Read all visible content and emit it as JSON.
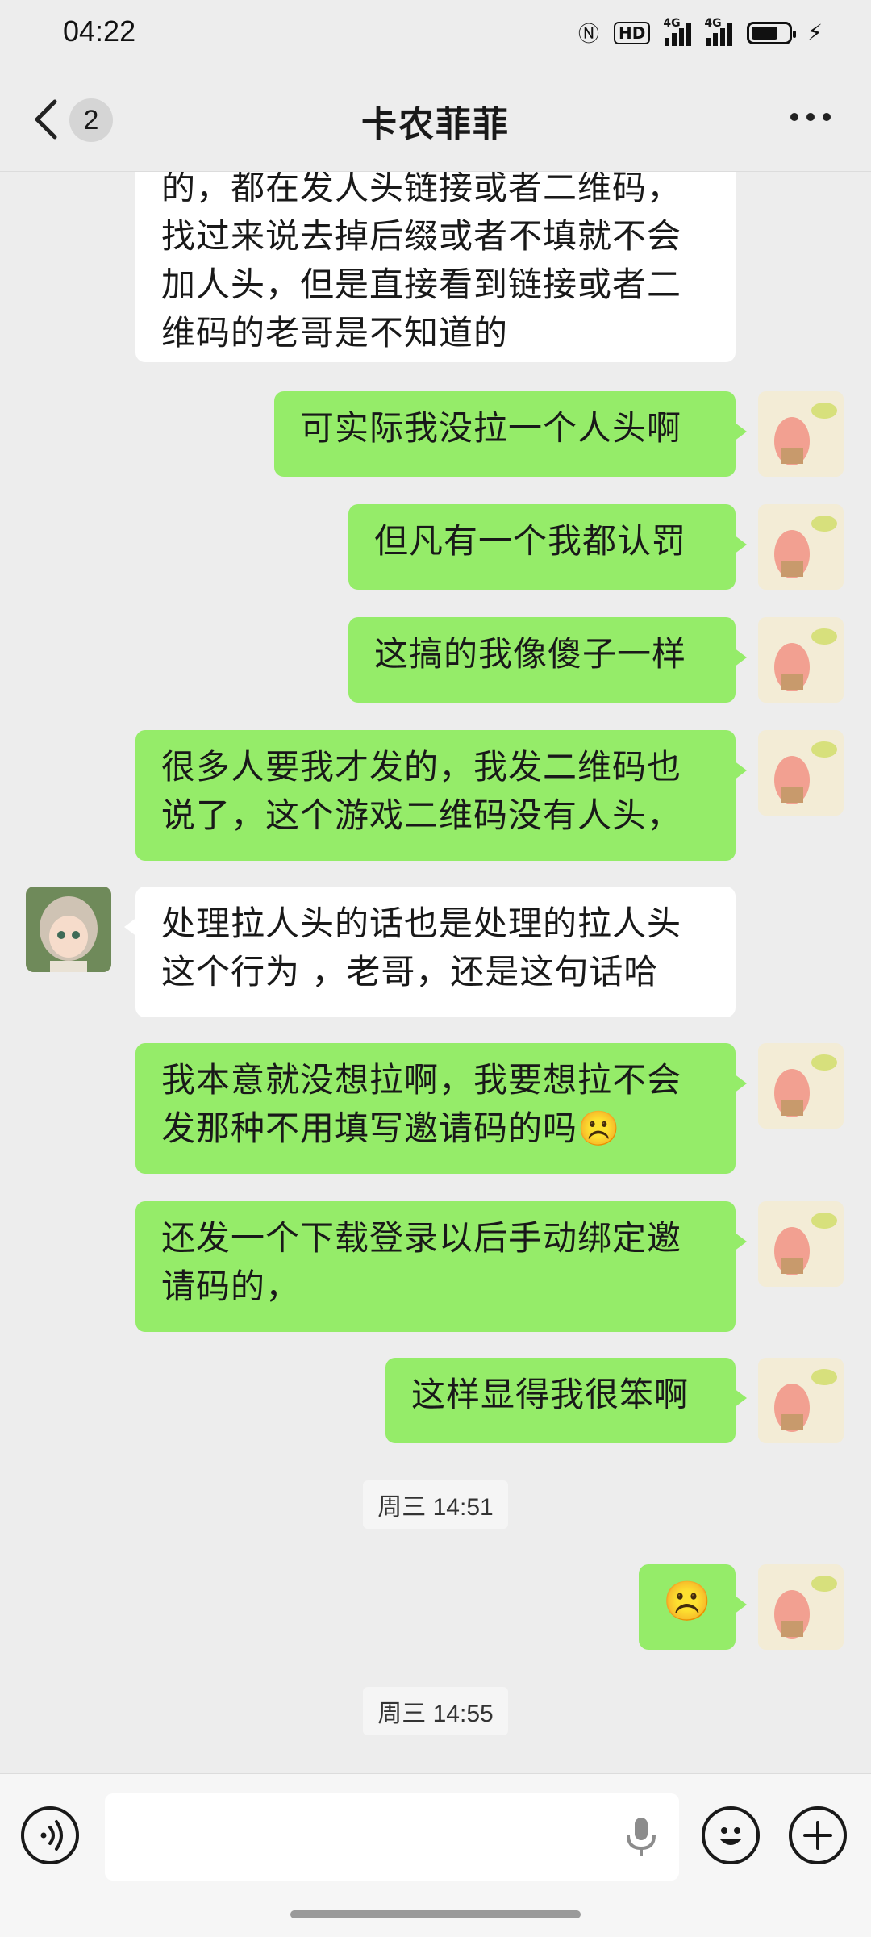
{
  "status_bar": {
    "time": "04:22",
    "network_labels": [
      "HD",
      "4G",
      "4G"
    ]
  },
  "header": {
    "back_label": "<",
    "unread_count": "2",
    "title": "卡农菲菲"
  },
  "messages": [
    {
      "sender": "other",
      "text": "的，都在发人头链接或者二维码，\n找过来说去掉后缀或者不填就不会\n加人头，但是直接看到链接或者二\n维码的老哥是不知道的"
    },
    {
      "sender": "me",
      "text": "可实际我没拉一个人头啊"
    },
    {
      "sender": "me",
      "text": "但凡有一个我都认罚"
    },
    {
      "sender": "me",
      "text": "这搞的我像傻子一样"
    },
    {
      "sender": "me",
      "text": "很多人要我才发的，我发二维码也\n说了，这个游戏二维码没有人头，"
    },
    {
      "sender": "other",
      "text": "处理拉人头的话也是处理的拉人头\n这个行为 ，老哥，还是这句话哈"
    },
    {
      "sender": "me",
      "text": "我本意就没想拉啊，我要想拉不会\n发那种不用填写邀请码的吗☹️"
    },
    {
      "sender": "me",
      "text": "还发一个下载登录以后手动绑定邀\n请码的，"
    },
    {
      "sender": "me",
      "text": "这样显得我很笨啊"
    },
    {
      "sender": "me",
      "text": "☹️"
    }
  ],
  "timestamps": [
    "周三 14:51",
    "周三 14:55"
  ],
  "input": {
    "placeholder": ""
  },
  "colors": {
    "out_bubble": "#95ec69",
    "in_bubble": "#ffffff",
    "background": "#ededed"
  },
  "icons": [
    "back-arrow-icon",
    "more-icon",
    "voice-icon",
    "microphone-icon",
    "emoji-icon",
    "plus-icon"
  ]
}
